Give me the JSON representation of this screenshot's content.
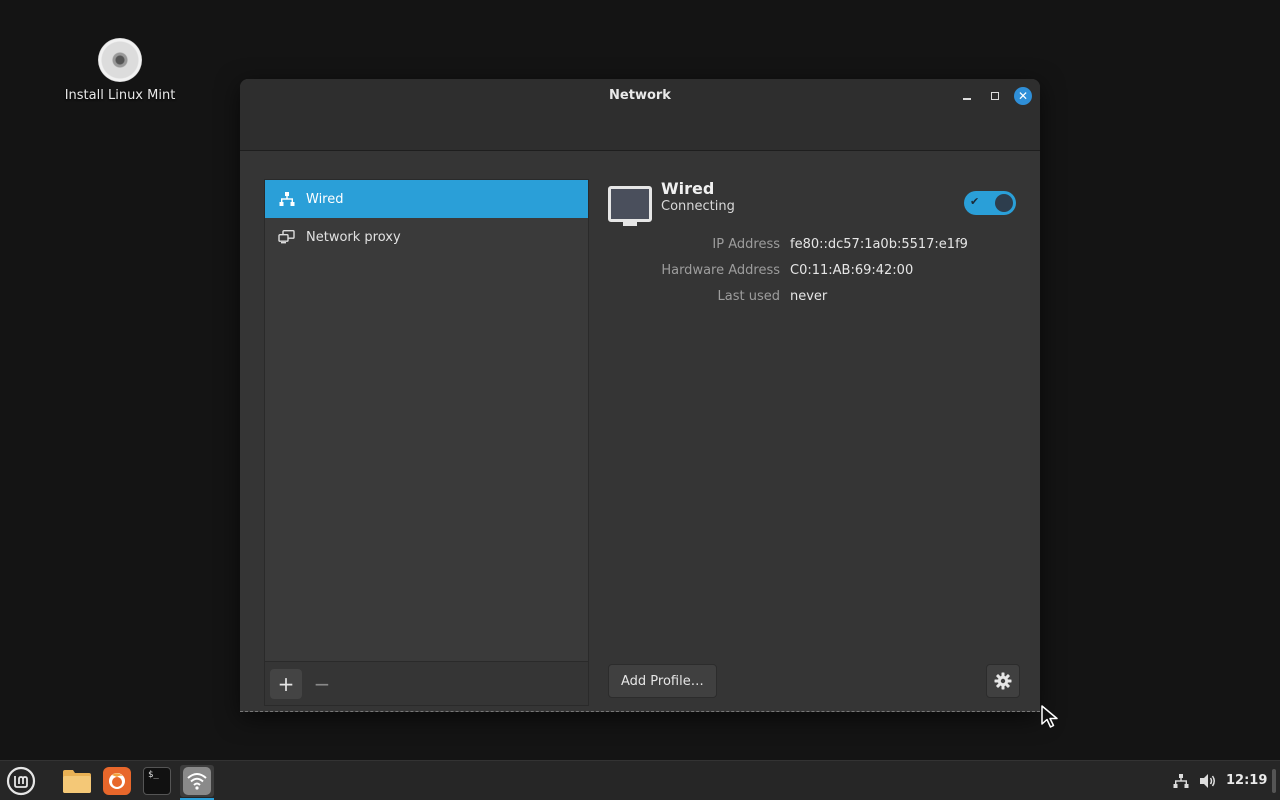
{
  "desktop": {
    "icons": [
      {
        "label": "Install Linux Mint",
        "icon": "disc-icon"
      }
    ]
  },
  "window": {
    "title": "Network",
    "controls": {
      "minimize": "minimize-icon",
      "maximize": "maximize-icon",
      "close": "close-icon"
    }
  },
  "sidebar": {
    "items": [
      {
        "label": "Wired",
        "icon": "wired-network-icon",
        "selected": true
      },
      {
        "label": "Network proxy",
        "icon": "network-proxy-icon",
        "selected": false
      }
    ],
    "add_label": "+",
    "remove_label": "−"
  },
  "detail": {
    "name": "Wired",
    "status": "Connecting",
    "toggle_on": true,
    "properties": [
      {
        "label": "IP Address",
        "value": "fe80::dc57:1a0b:5517:e1f9"
      },
      {
        "label": "Hardware Address",
        "value": "C0:11:AB:69:42:00"
      },
      {
        "label": "Last used",
        "value": "never"
      }
    ],
    "add_profile_label": "Add Profile…"
  },
  "taskbar": {
    "launchers": [
      "menu-icon",
      "files-icon",
      "firefox-icon",
      "terminal-icon",
      "network-settings-icon"
    ],
    "terminal_glyph": "$_",
    "clock": "12:19"
  },
  "colors": {
    "accent": "#2a9fd8",
    "window_bg": "#353535",
    "desktop_bg": "#141414"
  }
}
